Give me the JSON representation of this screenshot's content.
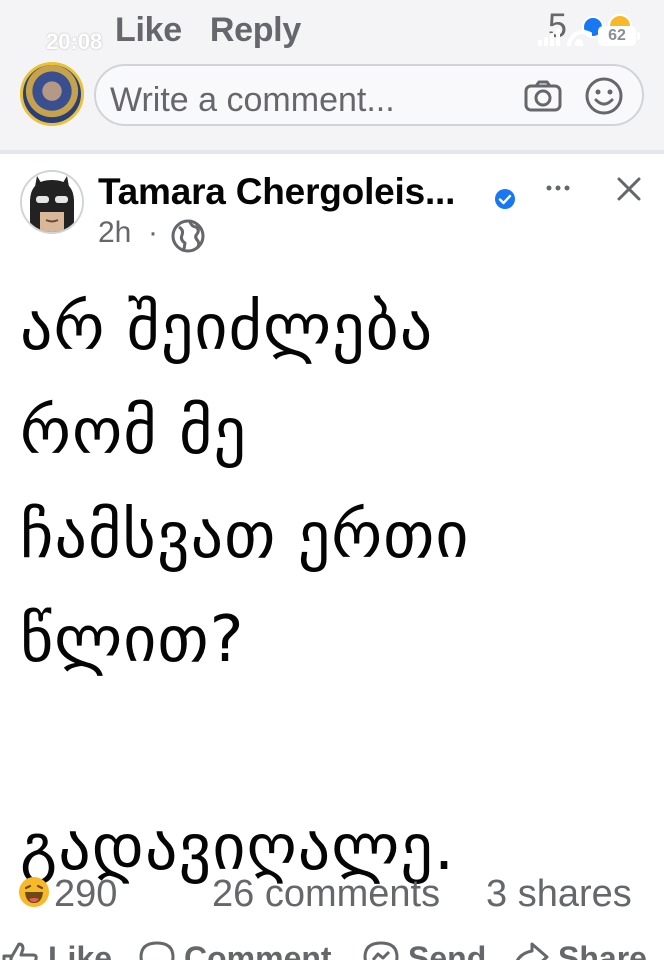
{
  "status_bar": {
    "time": "20:08",
    "battery": "62"
  },
  "previous_post": {
    "like_label": "Like",
    "reply_label": "Reply",
    "reaction_count": "5"
  },
  "comment_composer": {
    "placeholder": "Write a comment..."
  },
  "post": {
    "author": "Tamara Chergoleis...",
    "time": "2h",
    "separator": "·",
    "body_lines": [
      "არ შეიძლება",
      "რომ მე",
      "ჩამსვათ ერთი",
      "წლით?",
      "",
      "გადავიღალე."
    ],
    "reactions_count": "290",
    "comments_count": "26 comments",
    "shares_count": "3 shares"
  },
  "actions": {
    "like": "Like",
    "comment": "Comment",
    "send": "Send",
    "share": "Share"
  },
  "colors": {
    "accent": "#1877f2",
    "secondary_text": "#65676b",
    "reaction_yellow": "#f7b928"
  },
  "icons": [
    "camera-icon",
    "smile-icon",
    "verified-badge-icon",
    "more-icon",
    "close-icon",
    "globe-icon",
    "haha-reaction-icon",
    "like-icon",
    "comment-icon",
    "send-icon",
    "share-icon"
  ]
}
